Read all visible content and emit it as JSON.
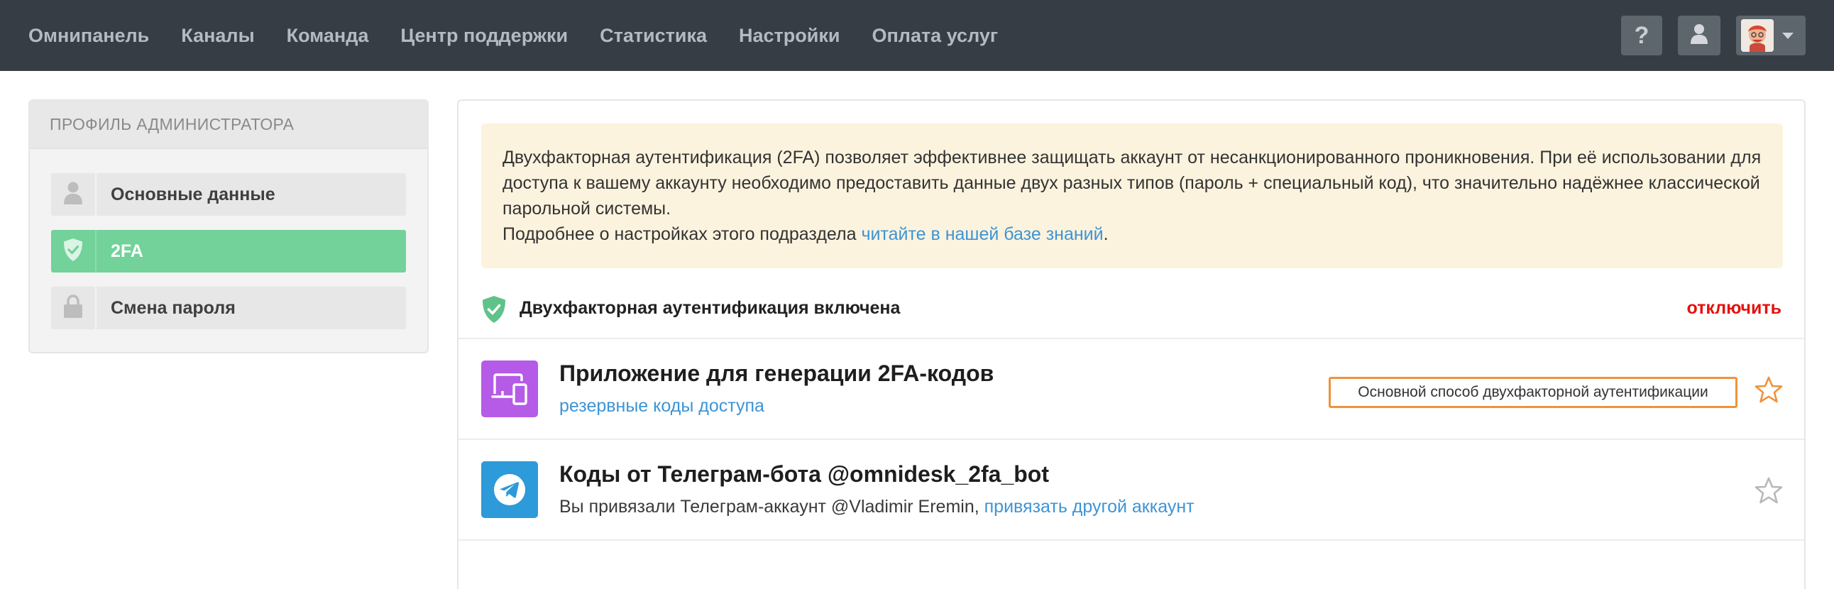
{
  "nav": {
    "items": [
      "Омнипанель",
      "Каналы",
      "Команда",
      "Центр поддержки",
      "Статистика",
      "Настройки",
      "Оплата услуг"
    ],
    "help_label": "?"
  },
  "sidebar": {
    "header": "ПРОФИЛЬ АДМИНИСТРАТОРА",
    "items": [
      {
        "label": "Основные данные",
        "icon": "user-icon"
      },
      {
        "label": "2FA",
        "icon": "shield-check-icon"
      },
      {
        "label": "Смена пароля",
        "icon": "lock-icon"
      }
    ]
  },
  "notice": {
    "text": "Двухфакторная аутентификация (2FA) позволяет эффективнее защищать аккаунт от несанкционированного проникновения. При её использовании для доступа к вашему аккаунту необходимо предоставить данные двух разных типов (пароль + специальный код), что значительно надёжнее классической парольной системы.",
    "more_prefix": "Подробнее о настройках этого подраздела ",
    "more_link": "читайте в нашей базе знаний",
    "more_suffix": "."
  },
  "status": {
    "text": "Двухфакторная аутентификация включена",
    "disable_label": "отключить"
  },
  "methods": [
    {
      "title": "Приложение для генерации 2FA-кодов",
      "link": "резервные коды доступа",
      "badge": "Основной способ двухфакторной аутентификации",
      "icon": "devices-icon",
      "color": "#b55be7"
    },
    {
      "title": "Коды от Телеграм-бота @omnidesk_2fa_bot",
      "sub_prefix": "Вы привязали Телеграм-аккаунт @Vladimir Eremin, ",
      "link": "привязать другой аккаунт",
      "icon": "telegram-icon",
      "color": "#2d9ad9"
    }
  ],
  "colors": {
    "topbar": "#363d45",
    "accent_green": "#72d299",
    "link": "#3d94d6",
    "danger": "#e3120f",
    "badge_border": "#f0923a"
  }
}
